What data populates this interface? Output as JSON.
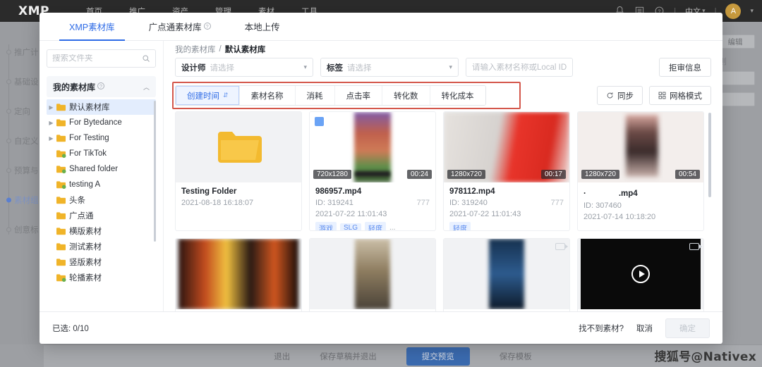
{
  "background": {
    "logo": "XMP",
    "nav": [
      "首页",
      "推广",
      "资产",
      "管理",
      "素材",
      "工具"
    ],
    "top_right": {
      "bell_icon": "bell-icon",
      "list_icon": "list-icon",
      "help_icon": "help-icon",
      "language": "中文",
      "avatar_letter": "A"
    },
    "steps": [
      {
        "label": "推广计",
        "active": false
      },
      {
        "label": "基础设",
        "active": false
      },
      {
        "label": "定向",
        "active": false
      },
      {
        "label": "自定义",
        "active": false
      },
      {
        "label": "预算与",
        "active": false
      },
      {
        "label": "素材组",
        "active": true
      },
      {
        "label": "创意标",
        "active": false
      }
    ],
    "right_panel": {
      "edit_label": "编辑",
      "rule_label": "规则"
    },
    "bottom_bar": {
      "exit": "退出",
      "save_draft_exit": "保存草稿并退出",
      "submit_preview": "提交预览",
      "save_template": "保存模板"
    },
    "watermark": "搜狐号@Nativex"
  },
  "modal": {
    "tabs": [
      {
        "label": "XMP素材库",
        "active": true,
        "help": false
      },
      {
        "label": "广点通素材库",
        "active": false,
        "help": true
      },
      {
        "label": "本地上传",
        "active": false,
        "help": false
      }
    ],
    "folders": {
      "search_placeholder": "搜索文件夹",
      "search_value": "",
      "search_icon": "search-icon",
      "library_label": "我的素材库",
      "library_help_icon": "help-icon",
      "collapse_icon": "chevron-up-icon",
      "items": [
        {
          "label": "默认素材库",
          "expandable": true,
          "selected": true,
          "shared": false
        },
        {
          "label": "For Bytedance",
          "expandable": true,
          "selected": false,
          "shared": false
        },
        {
          "label": "For Testing",
          "expandable": true,
          "selected": false,
          "shared": false
        },
        {
          "label": "For TikTok",
          "expandable": false,
          "selected": false,
          "shared": true
        },
        {
          "label": "Shared folder",
          "expandable": false,
          "selected": false,
          "shared": true
        },
        {
          "label": "testing A",
          "expandable": false,
          "selected": false,
          "shared": true
        },
        {
          "label": "头条",
          "expandable": false,
          "selected": false,
          "shared": false
        },
        {
          "label": "广点通",
          "expandable": false,
          "selected": false,
          "shared": false
        },
        {
          "label": "横版素材",
          "expandable": false,
          "selected": false,
          "shared": false
        },
        {
          "label": "测试素材",
          "expandable": false,
          "selected": false,
          "shared": false
        },
        {
          "label": "竖版素材",
          "expandable": false,
          "selected": false,
          "shared": false
        },
        {
          "label": "轮播素材",
          "expandable": false,
          "selected": false,
          "shared": true
        }
      ]
    },
    "breadcrumb": {
      "root": "我的素材库",
      "separator": "/",
      "current": "默认素材库"
    },
    "filters": {
      "designer_label": "设计师",
      "designer_placeholder": "请选择",
      "tag_label": "标签",
      "tag_placeholder": "请选择",
      "name_placeholder": "请输入素材名称或Local ID",
      "name_value": "",
      "reject_info_label": "拒审信息"
    },
    "sort_tabs": [
      {
        "label": "创建时间",
        "active": true,
        "sort_icon": "sort-desc-icon"
      },
      {
        "label": "素材名称",
        "active": false
      },
      {
        "label": "消耗",
        "active": false
      },
      {
        "label": "点击率",
        "active": false
      },
      {
        "label": "转化数",
        "active": false
      },
      {
        "label": "转化成本",
        "active": false
      }
    ],
    "actions": {
      "sync_label": "同步",
      "sync_icon": "refresh-icon",
      "grid_mode_label": "网格模式",
      "grid_mode_icon": "grid-icon"
    },
    "cards": [
      {
        "kind": "folder",
        "title": "Testing Folder",
        "date": "2021-08-18 16:18:07",
        "folder_icon": "folder-icon"
      },
      {
        "kind": "video",
        "resolution": "720x1280",
        "duration": "00:24",
        "title": "986957.mp4",
        "id": "ID: 319241",
        "count": "777",
        "date": "2021-07-22 11:01:43",
        "tags": [
          "游戏",
          "SLG",
          "轻度"
        ],
        "tags_more": "...",
        "checked": true,
        "orientation": "portrait"
      },
      {
        "kind": "video",
        "resolution": "1280x720",
        "duration": "00:17",
        "title": "978112.mp4",
        "id": "ID: 319240",
        "count": "777",
        "date": "2021-07-22 11:01:43",
        "tags": [
          "轻度"
        ],
        "tags_more": "",
        "checked": false,
        "orientation": "landscape"
      },
      {
        "kind": "video",
        "resolution": "1280x720",
        "duration": "00:54",
        "title": "·　　　　.mp4",
        "id": "ID: 307460",
        "count": "",
        "date": "2021-07-14 10:18:20",
        "tags": [],
        "tags_more": "",
        "checked": false,
        "orientation": "landscape"
      }
    ],
    "cards_row2": [
      {
        "kind": "video",
        "orientation": "landscape",
        "video_icon": ""
      },
      {
        "kind": "video",
        "orientation": "portrait",
        "video_icon": ""
      },
      {
        "kind": "video",
        "orientation": "portrait",
        "video_icon": "video-icon"
      },
      {
        "kind": "video",
        "orientation": "landscape-dark",
        "video_icon": "video-icon",
        "play_icon": "play-icon"
      }
    ],
    "footer": {
      "selected_count": "已选: 0/10",
      "not_found_label": "找不到素材?",
      "cancel_label": "取消",
      "confirm_label": "确定"
    }
  },
  "colors": {
    "accent": "#2e6be6",
    "highlight_box": "#d4574b",
    "folder_yellow": "#f3ba2f",
    "tag_blue": "#5a8bef"
  }
}
